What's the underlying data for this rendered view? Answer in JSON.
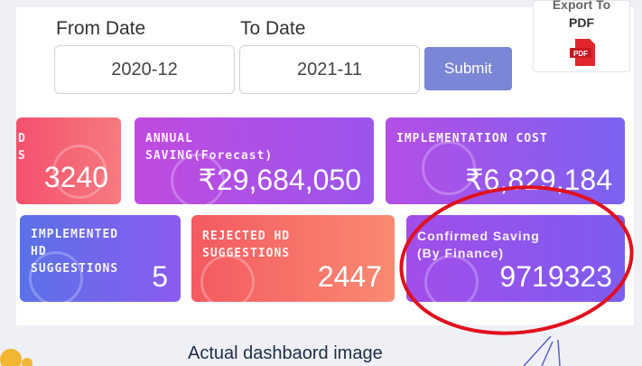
{
  "filters": {
    "from_label": "From Date",
    "from_value": "2020-12",
    "to_label": "To Date",
    "to_value": "2021-11",
    "submit_label": "Submit"
  },
  "export": {
    "line1": "Export To",
    "line2": "PDF",
    "icon": "pdf-icon"
  },
  "cards": [
    {
      "title": "D\nS",
      "value": "3240",
      "color": "#f4506e"
    },
    {
      "title": "ANNUAL\nSAVING(Forecast)",
      "value": "₹29,684,050",
      "color": "#b24fe5"
    },
    {
      "title": "IMPLEMENTATION COST",
      "value": "₹6,829,184",
      "color": "#9a58ec"
    },
    {
      "title": "IMPLEMENTED\nHD\nSUGGESTIONS",
      "value": "5",
      "color": "#5a72e8"
    },
    {
      "title": "REJECTED HD\nSUGGESTIONS",
      "value": "2447",
      "color": "#f45a60"
    },
    {
      "title": "Confirmed Saving\n(By Finance)",
      "value": "9719323",
      "color": "#a24ee9"
    }
  ],
  "annotation": {
    "caption": "Actual dashbaord image",
    "ellipse_color": "#e0101e"
  }
}
